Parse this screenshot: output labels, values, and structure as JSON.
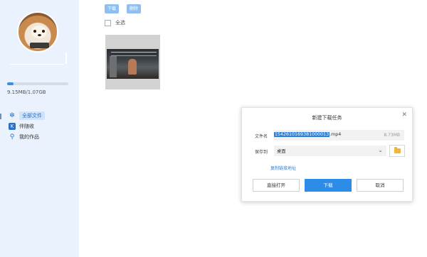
{
  "sidebar": {
    "storage_text": "9.15MB/1.07GB",
    "storage_used_fraction": 0.1,
    "nav": [
      {
        "label": "全部文件",
        "icon": "snowflake-icon",
        "active": true
      },
      {
        "label": "伴随收",
        "icon": "k-logo-icon",
        "active": false
      },
      {
        "label": "我的作品",
        "icon": "person-icon",
        "active": false
      }
    ]
  },
  "toolbar": {
    "download_label": "下载",
    "delete_label": "删除"
  },
  "main": {
    "select_all_label": "全选"
  },
  "dialog": {
    "title": "新建下载任务",
    "filename_label": "文件名",
    "filename_selected": "1542610169381000013",
    "filename_ext": ".mp4",
    "filesize": "8.73MB",
    "saveto_label": "保存到",
    "saveto_value": "桌面",
    "copy_link_label": "复制链接地址",
    "btn_open": "直接打开",
    "btn_download": "下载",
    "btn_cancel": "取消"
  },
  "colors": {
    "accent": "#2d8ce8",
    "sidebar_bg": "#eaf3fd",
    "toolbar_btn": "#8fbff0"
  }
}
